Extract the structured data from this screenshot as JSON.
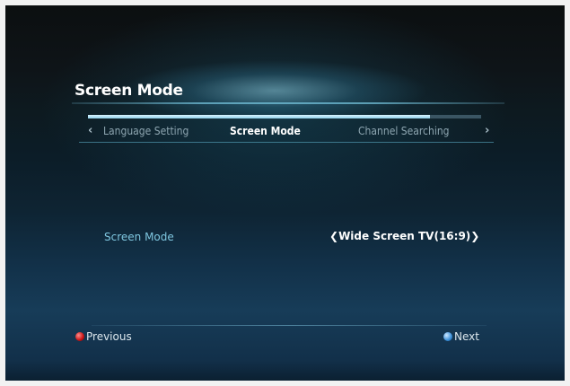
{
  "header": {
    "title": "Screen Mode"
  },
  "wizard": {
    "progress_fraction": 0.87,
    "prev_arrow": "‹",
    "next_arrow": "›",
    "steps": [
      {
        "label": "Language Setting"
      },
      {
        "label": "Screen Mode"
      },
      {
        "label": "Channel Searching"
      }
    ],
    "active_step": 1
  },
  "setting": {
    "label": "Screen Mode",
    "value": "Wide Screen TV(16:9)",
    "left_chevron": "❮",
    "right_chevron": "❯"
  },
  "footer": {
    "previous_label": "Previous",
    "next_label": "Next"
  },
  "colors": {
    "accent": "#7fc7e0",
    "previous_button": "#c81212",
    "next_button": "#3a8fd8"
  }
}
